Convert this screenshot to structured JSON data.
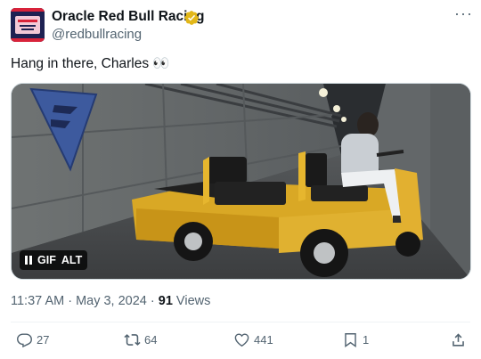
{
  "account": {
    "name": "Oracle Red Bull Racing",
    "handle": "@redbullracing",
    "verified": true,
    "badge_color": "#e2b719"
  },
  "more_icon": "more-horizontal-icon",
  "tweet": {
    "text": "Hang in there, Charles 👀",
    "media": {
      "type": "GIF",
      "pause_icon": "pause-icon",
      "gif_label": "GIF",
      "alt_label": "ALT"
    },
    "time": "11:37 AM · May 3, 2024 · ",
    "views_count": "91",
    "views_label": " Views"
  },
  "actions": {
    "replies": "27",
    "reposts": "64",
    "likes": "441",
    "bookmarks": "1"
  }
}
